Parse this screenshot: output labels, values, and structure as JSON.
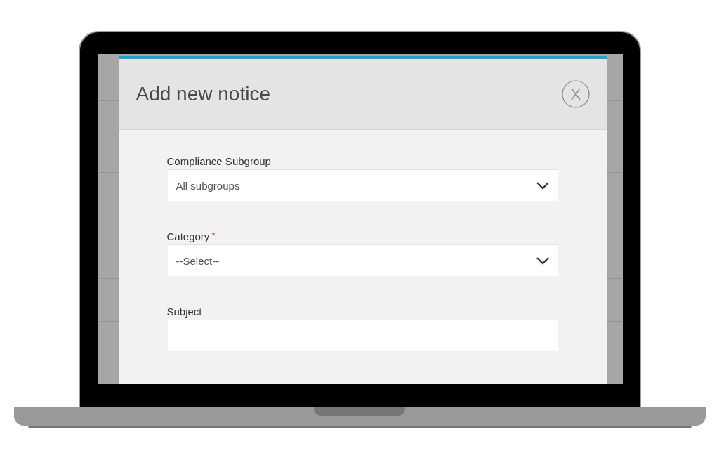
{
  "dialog": {
    "title": "Add new notice",
    "fields": [
      {
        "label": "Compliance Subgroup",
        "kind": "select",
        "value": "All subgroups"
      },
      {
        "label": "Category",
        "kind": "select",
        "value": "--Select--",
        "required_mark": "*"
      },
      {
        "label": "Subject",
        "kind": "text"
      }
    ]
  }
}
